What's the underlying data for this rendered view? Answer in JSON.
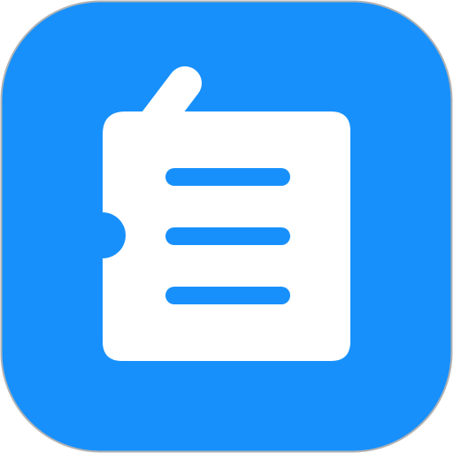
{
  "app_icon": {
    "icon_name": "notes-icon",
    "background_color": "#1890fb",
    "border_color": "#b3b3b3",
    "glyph_color": "#ffffff",
    "line_color": "#1890fb"
  }
}
